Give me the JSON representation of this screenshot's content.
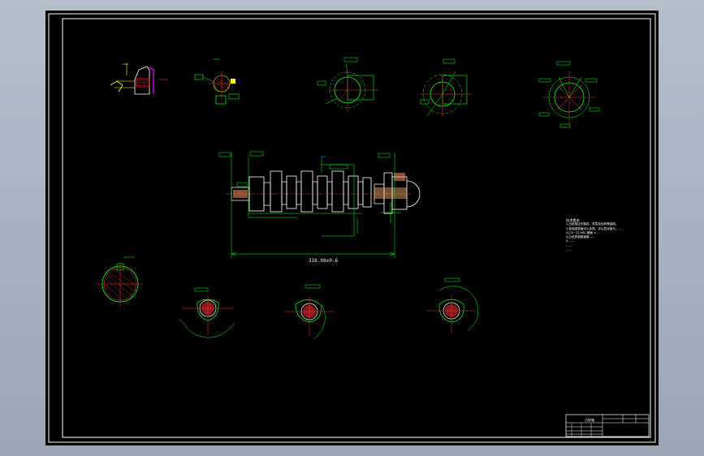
{
  "drawing": {
    "colors": {
      "background": "#000000",
      "frame": "#ffffff",
      "geometry": "#00ff00",
      "centerline": "#ff3030",
      "hatch": "#ff3030",
      "dimension": "#00ff00",
      "highlight": "#ffff00",
      "accent": "#ff00ff",
      "text": "#ffffff",
      "window": "#a8b3c2"
    },
    "main_dimension": "318.08±0.6",
    "technical_requirements": {
      "title": "技术要求",
      "lines": [
        "1.凸轮轴应无裂纹、夹层及毛刺等缺陷。",
        "2.各轴颈表面淬火处理，淬火层深度为……",
        "3.[15~2] HRC,硬度 ±…",
        "4.凸轮表面粗糙度……",
        "5.……",
        "……",
        "……"
      ]
    },
    "title_block": {
      "name": "凸轮轴"
    },
    "icons": [
      "crosshair-icon"
    ]
  }
}
